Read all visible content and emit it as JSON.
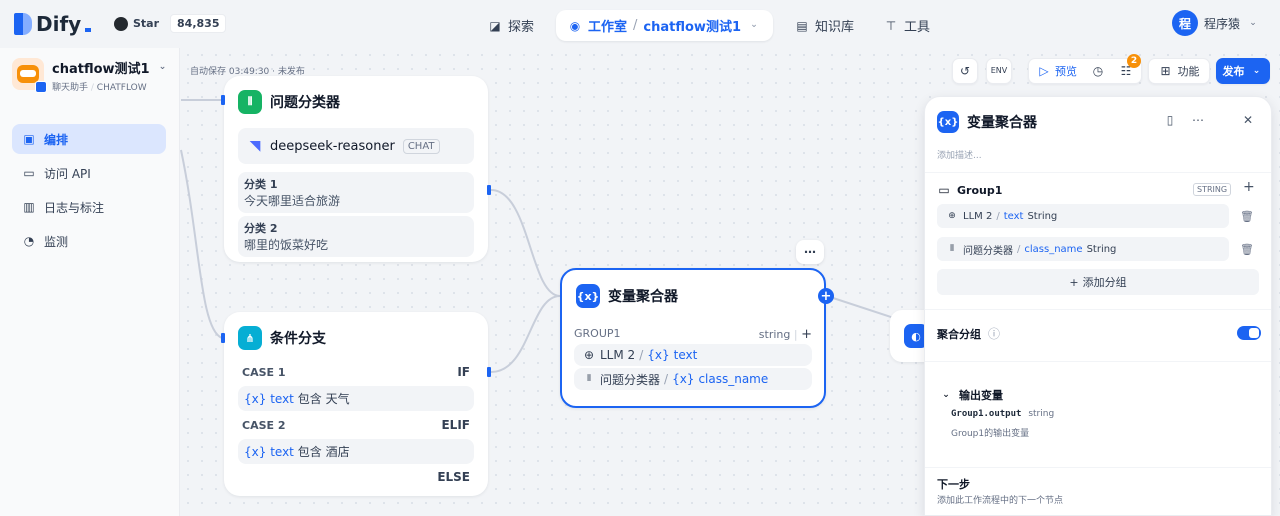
{
  "topbar": {
    "brand": "Dify",
    "github_label": "Star",
    "github_count": "84,835",
    "nav": {
      "explore": "探索",
      "studio": "工作室",
      "separator": "/",
      "app_switch": "chatflow测试1",
      "knowledge": "知识库",
      "tools": "工具"
    },
    "user_avatar": "程",
    "user_name": "程序猿"
  },
  "sidebar": {
    "app_name": "chatflow测试1",
    "app_type": "聊天助手",
    "app_mode": "CHATFLOW",
    "items": [
      {
        "label": "编排",
        "icon": "layout-icon",
        "active": true
      },
      {
        "label": "访问 API",
        "icon": "terminal-icon",
        "active": false
      },
      {
        "label": "日志与标注",
        "icon": "file-icon",
        "active": false
      },
      {
        "label": "监测",
        "icon": "monitor-icon",
        "active": false
      }
    ]
  },
  "canvas": {
    "autosave": "自动保存 03:49:30 · 未发布"
  },
  "toolbar": {
    "preview": "预览",
    "checklist_count": "2",
    "features": "功能",
    "publish": "发布"
  },
  "nodes": {
    "classifier": {
      "title": "问题分类器",
      "model": "deepseek-reasoner",
      "model_tag": "CHAT",
      "classes": [
        {
          "title": "分类 1",
          "value": "今天哪里适合旅游"
        },
        {
          "title": "分类 2",
          "value": "哪里的饭菜好吃"
        }
      ]
    },
    "ifelse": {
      "title": "条件分支",
      "cases": [
        {
          "label": "CASE 1",
          "keyword": "IF",
          "var_prefix": "{x}",
          "var": "text",
          "op": "包含",
          "value": "天气"
        },
        {
          "label": "CASE 2",
          "keyword": "ELIF",
          "var_prefix": "{x}",
          "var": "text",
          "op": "包含",
          "value": "酒店"
        }
      ],
      "else_label": "ELSE"
    },
    "aggregator": {
      "title": "变量聚合器",
      "group_name": "GROUP1",
      "group_type": "string",
      "vars": [
        {
          "source": "LLM 2",
          "sep": "/",
          "prefix": "{x}",
          "name": "text"
        },
        {
          "source": "问题分类器",
          "sep": "/",
          "prefix": "{x}",
          "name": "class_name"
        }
      ]
    }
  },
  "panel": {
    "title": "变量聚合器",
    "description_placeholder": "添加描述...",
    "group_name": "Group1",
    "group_type_badge": "STRING",
    "vars": [
      {
        "source": "LLM 2",
        "sep": "/",
        "name": "text",
        "type": "String"
      },
      {
        "source": "问题分类器",
        "sep": "/",
        "name": "class_name",
        "type": "String"
      }
    ],
    "add_group": "添加分组",
    "group_toggle_label": "聚合分组",
    "group_toggle_on": true,
    "output_title": "输出变量",
    "output_var": "Group1.output",
    "output_type": "string",
    "output_desc": "Group1的输出变量",
    "next_step_title": "下一步",
    "next_step_desc": "添加此工作流程中的下一个节点"
  },
  "colors": {
    "accent": "#1c64f2",
    "classifier_icon": "#16b364",
    "ifelse_icon": "#06aed4",
    "aggregator_icon": "#1c64f2"
  }
}
